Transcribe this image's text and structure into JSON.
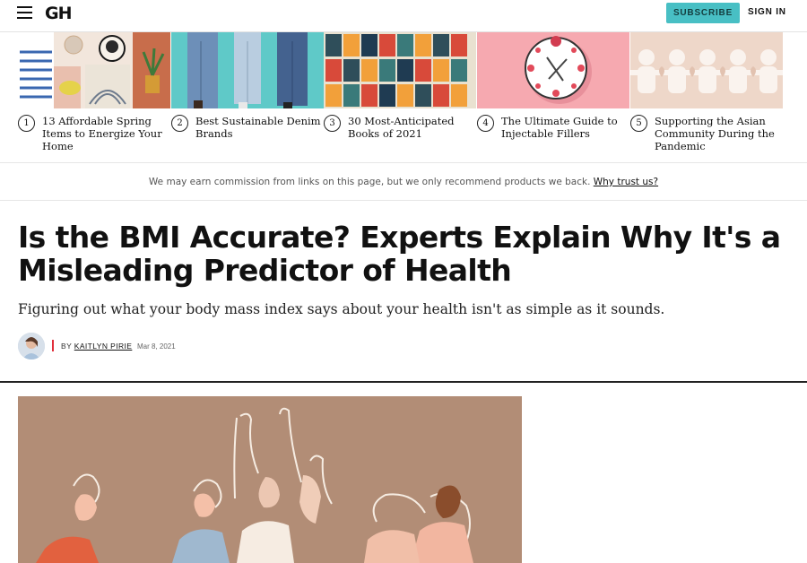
{
  "header": {
    "logo": "GH",
    "subscribe_label": "SUBSCRIBE",
    "signin_label": "SIGN IN",
    "menu_icon": "hamburger-menu-icon",
    "accent_color": "#48bfc4"
  },
  "trending": [
    {
      "num": "1",
      "title": "13 Affordable Spring Items to Energize Your Home"
    },
    {
      "num": "2",
      "title": "Best Sustainable Denim Brands"
    },
    {
      "num": "3",
      "title": "30 Most-Anticipated Books of 2021"
    },
    {
      "num": "4",
      "title": "The Ultimate Guide to Injectable Fillers"
    },
    {
      "num": "5",
      "title": "Supporting the Asian Community During the Pandemic"
    }
  ],
  "disclaimer": {
    "text": "We may earn commission from links on this page, but we only recommend products we back.",
    "link": "Why trust us?"
  },
  "article": {
    "title": "Is the BMI Accurate? Experts Explain Why It's a Misleading Predictor of Health",
    "dek": "Figuring out what your body mass index says about your health isn't as simple as it sounds.",
    "by_prefix": "BY",
    "author": "KAITLYN PIRIE",
    "date": "Mar 8, 2021",
    "accent_bar_color": "#e12e3b"
  }
}
